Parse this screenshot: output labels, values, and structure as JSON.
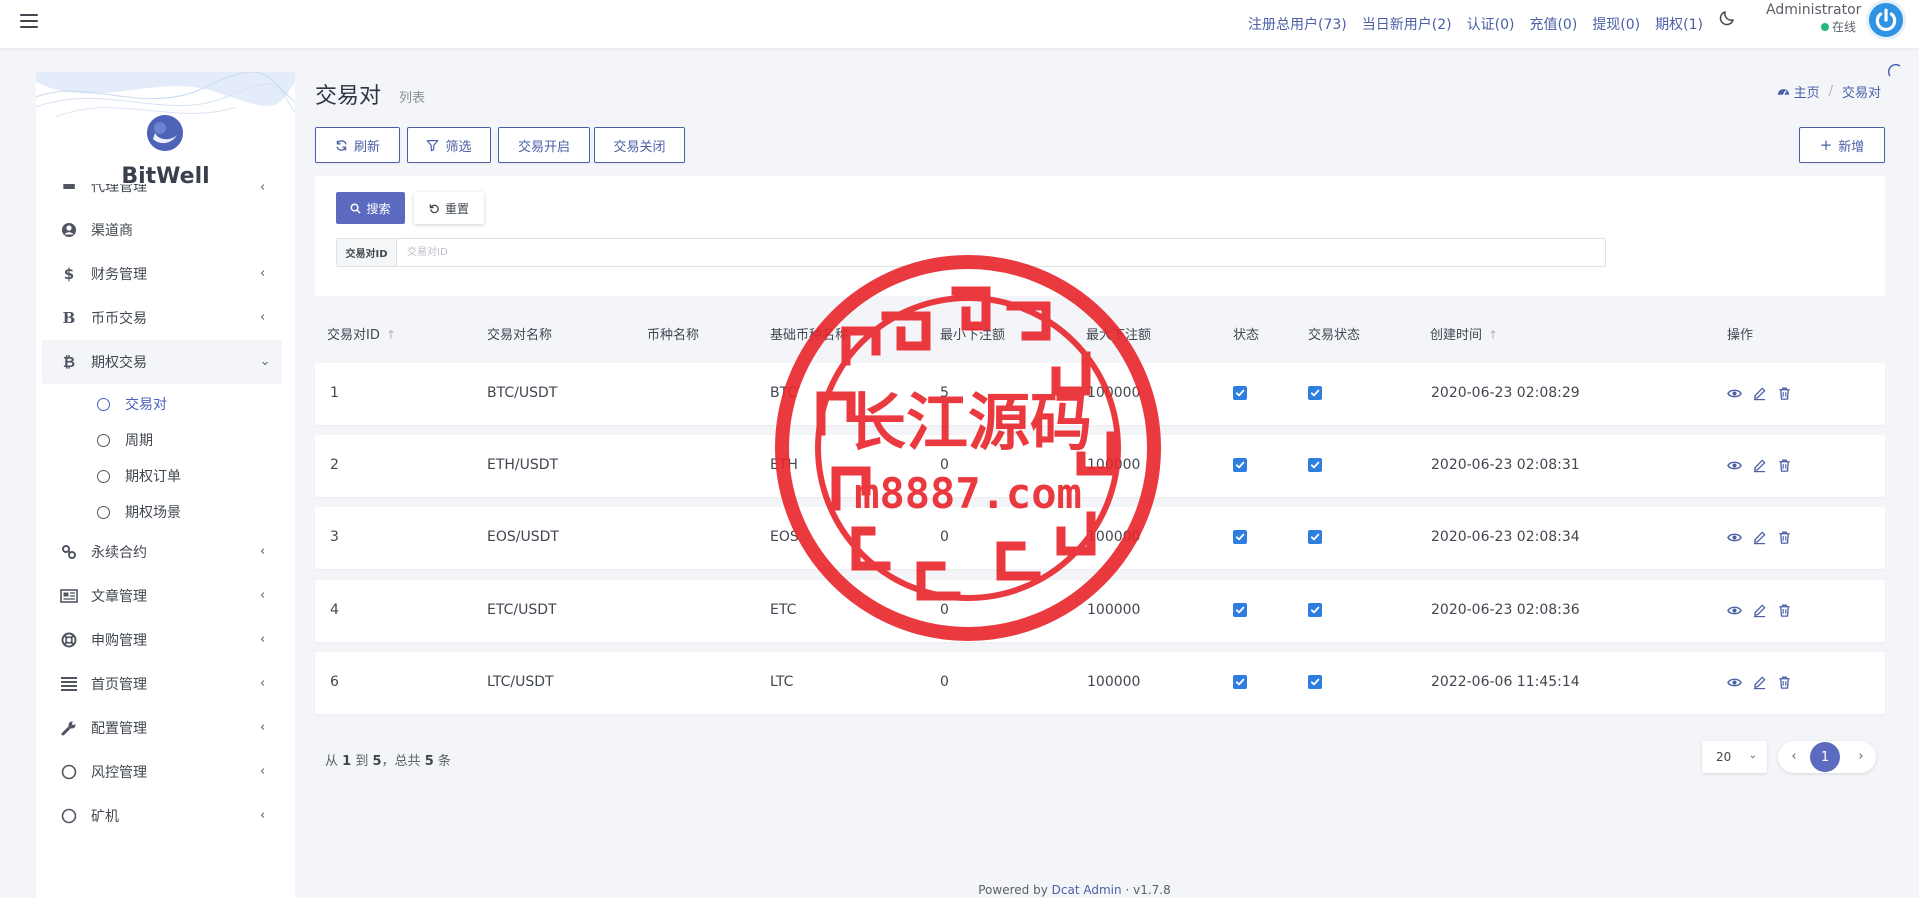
{
  "navbar": {
    "links": [
      "注册总用户(73)",
      "当日新用户(2)",
      "认证(0)",
      "充值(0)",
      "提现(0)",
      "期权(1)"
    ],
    "user_name": "Administrator",
    "user_status": "在线"
  },
  "sidebar": {
    "brand": "BitWell",
    "partial_item": "代理管理",
    "items": [
      {
        "label": "渠道商",
        "icon": "user-circle-icon"
      },
      {
        "label": "财务管理",
        "icon": "dollar-icon"
      },
      {
        "label": "币币交易",
        "icon": "bold-b-icon"
      },
      {
        "label": "期权交易",
        "icon": "bitcoin-icon"
      }
    ],
    "submenu": [
      "交易对",
      "周期",
      "期权订单",
      "期权场景"
    ],
    "items_after": [
      {
        "label": "永续合约",
        "icon": "link-icon"
      },
      {
        "label": "文章管理",
        "icon": "newspaper-icon"
      },
      {
        "label": "申购管理",
        "icon": "lifebuoy-icon"
      },
      {
        "label": "首页管理",
        "icon": "bars-icon"
      },
      {
        "label": "配置管理",
        "icon": "wrench-icon"
      },
      {
        "label": "风控管理",
        "icon": "circle-icon"
      },
      {
        "label": "矿机",
        "icon": "circle-icon"
      }
    ]
  },
  "page": {
    "title": "交易对",
    "subtitle": "列表",
    "breadcrumb_home": "主页",
    "breadcrumb_current": "交易对"
  },
  "toolbar": {
    "refresh": "刷新",
    "filter": "筛选",
    "open": "交易开启",
    "close": "交易关闭",
    "add": "新增"
  },
  "filter": {
    "search": "搜索",
    "reset": "重置",
    "field_label": "交易对ID",
    "field_placeholder": "交易对ID",
    "field_value": ""
  },
  "table": {
    "headers": [
      "交易对ID",
      "交易对名称",
      "币种名称",
      "基础币种名称",
      "最小下注额",
      "最大下注额",
      "状态",
      "交易状态",
      "创建时间",
      "操作"
    ],
    "rows": [
      {
        "id": "1",
        "name": "BTC/USDT",
        "coin": "",
        "base": "BTC",
        "min": "5",
        "max": "100000",
        "status": true,
        "trade_status": true,
        "created": "2020-06-23 02:08:29"
      },
      {
        "id": "2",
        "name": "ETH/USDT",
        "coin": "",
        "base": "ETH",
        "min": "0",
        "max": "100000",
        "status": true,
        "trade_status": true,
        "created": "2020-06-23 02:08:31"
      },
      {
        "id": "3",
        "name": "EOS/USDT",
        "coin": "",
        "base": "EOS",
        "min": "0",
        "max": "100000",
        "status": true,
        "trade_status": true,
        "created": "2020-06-23 02:08:34"
      },
      {
        "id": "4",
        "name": "ETC/USDT",
        "coin": "",
        "base": "ETC",
        "min": "0",
        "max": "100000",
        "status": true,
        "trade_status": true,
        "created": "2020-06-23 02:08:36"
      },
      {
        "id": "6",
        "name": "LTC/USDT",
        "coin": "",
        "base": "LTC",
        "min": "0",
        "max": "100000",
        "status": true,
        "trade_status": true,
        "created": "2022-06-06 11:45:14"
      }
    ]
  },
  "pagination": {
    "info_from": "从",
    "from": "1",
    "info_to": "到",
    "to": "5",
    "info_total": "，总共",
    "total": "5",
    "info_unit": "条",
    "per_page": "20",
    "current": "1"
  },
  "footer": {
    "powered_by": "Powered by",
    "link": "Dcat Admin",
    "dot": "·",
    "version": "v1.7.8"
  },
  "watermark": {
    "line1": "长江源码",
    "line2": "m8887.com"
  },
  "colors": {
    "primary": "#5c6bc0",
    "link": "#4c60a8",
    "checkbox": "#2f7de1",
    "online": "#21b978",
    "stamp": "#e8252b"
  }
}
